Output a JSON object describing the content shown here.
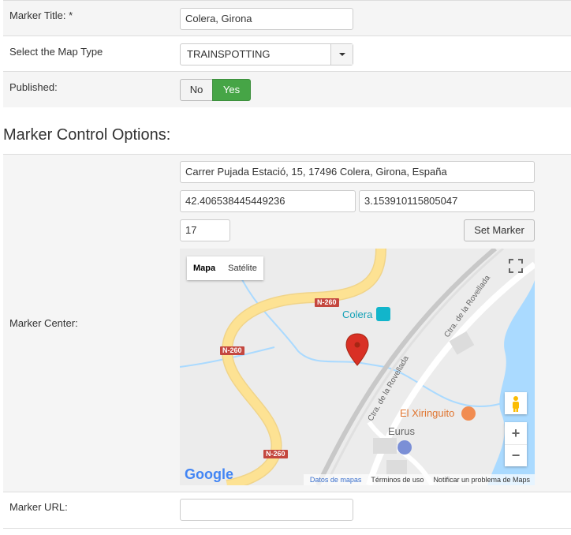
{
  "fields": {
    "title_label": "Marker Title: *",
    "title_value": "Colera, Girona",
    "maptype_label": "Select the Map Type",
    "maptype_value": "TRAINSPOTTING",
    "published_label": "Published:",
    "published_no": "No",
    "published_yes": "Yes",
    "section_heading": "Marker Control Options:",
    "center_label": "Marker Center:",
    "address_value": "Carrer Pujada Estació, 15, 17496 Colera, Girona, España",
    "lat_value": "42.406538445449236",
    "lng_value": "3.153910115805047",
    "zoom_value": "17",
    "set_marker": "Set Marker",
    "url_label": "Marker URL:",
    "url_value": ""
  },
  "map": {
    "type_map": "Mapa",
    "type_satellite": "Satélite",
    "place_colera": "Colera",
    "place_xiringuito": "El Xiringuito",
    "place_eurus": "Eurus",
    "road_n260": "N-260",
    "street_1": "Ctra. de la Rovellada",
    "street_2": "Ctra. de la Rovellada",
    "logo": "Google",
    "footer_data": "Datos de mapas",
    "footer_terms": "Términos de uso",
    "footer_report": "Notificar un problema de Maps",
    "zoom_in": "+",
    "zoom_out": "−"
  },
  "colors": {
    "published_yes": "#46a546",
    "marker_red": "#d93025",
    "water": "#aadaff",
    "highway": "#fde293"
  }
}
